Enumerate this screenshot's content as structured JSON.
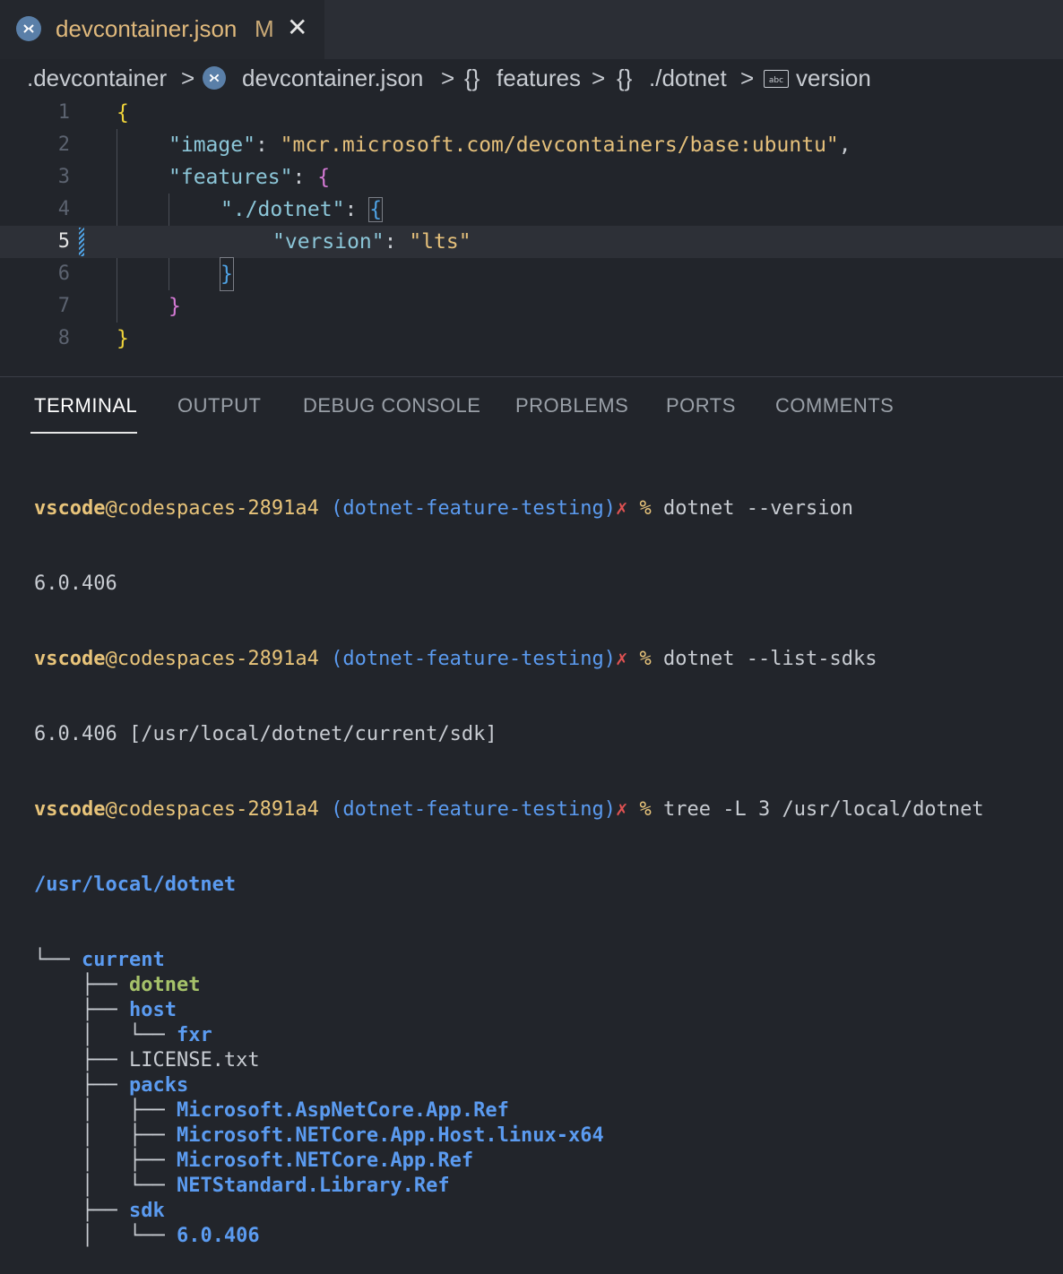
{
  "tab": {
    "label": "devcontainer.json",
    "modified": "M",
    "close": "✕"
  },
  "breadcrumb": {
    "folder": ".devcontainer",
    "file": "devcontainer.json",
    "features": "features",
    "dotnet": "./dotnet",
    "version": "version",
    "sep": ">",
    "obj": "{}"
  },
  "editor": {
    "line_numbers": [
      "1",
      "2",
      "3",
      "4",
      "5",
      "6",
      "7",
      "8"
    ],
    "l1": "{",
    "l2_key": "\"image\"",
    "l2_colon": ": ",
    "l2_val": "\"mcr.microsoft.com/devcontainers/base:ubuntu\"",
    "l2_comma": ",",
    "l3_key": "\"features\"",
    "l3_colon": ": ",
    "l3_brace": "{",
    "l4_key": "\"./dotnet\"",
    "l4_colon": ": ",
    "l4_brace": "{",
    "l5_key": "\"version\"",
    "l5_colon": ": ",
    "l5_val": "\"lts\"",
    "l6": "}",
    "l7": "}",
    "l8": "}"
  },
  "panel": {
    "tabs": [
      "TERMINAL",
      "OUTPUT",
      "DEBUG CONSOLE",
      "PROBLEMS",
      "PORTS",
      "COMMENTS"
    ]
  },
  "terminal": {
    "user": "vscode",
    "at_host": "@codespaces-2891a4",
    "branch": " (dotnet-feature-testing)",
    "x": "✗",
    "pct": " %",
    "cmd1": " dotnet --version",
    "out1": "6.0.406",
    "cmd2": " dotnet --list-sdks",
    "out2": "6.0.406 [/usr/local/dotnet/current/sdk]",
    "cmd3": " tree -L 3 /usr/local/dotnet",
    "root": "/usr/local/dotnet",
    "tree": [
      {
        "prefix": "└── ",
        "name": "current",
        "kind": "dir"
      },
      {
        "prefix": "    ├── ",
        "name": "dotnet",
        "kind": "exe"
      },
      {
        "prefix": "    ├── ",
        "name": "host",
        "kind": "dir"
      },
      {
        "prefix": "    │   └── ",
        "name": "fxr",
        "kind": "dir"
      },
      {
        "prefix": "    ├── ",
        "name": "LICENSE.txt",
        "kind": "file"
      },
      {
        "prefix": "    ├── ",
        "name": "packs",
        "kind": "dir"
      },
      {
        "prefix": "    │   ├── ",
        "name": "Microsoft.AspNetCore.App.Ref",
        "kind": "dir"
      },
      {
        "prefix": "    │   ├── ",
        "name": "Microsoft.NETCore.App.Host.linux-x64",
        "kind": "dir"
      },
      {
        "prefix": "    │   ├── ",
        "name": "Microsoft.NETCore.App.Ref",
        "kind": "dir"
      },
      {
        "prefix": "    │   └── ",
        "name": "NETStandard.Library.Ref",
        "kind": "dir"
      },
      {
        "prefix": "    ├── ",
        "name": "sdk",
        "kind": "dir"
      },
      {
        "prefix": "    │   └── ",
        "name": "6.0.406",
        "kind": "dir"
      }
    ]
  }
}
